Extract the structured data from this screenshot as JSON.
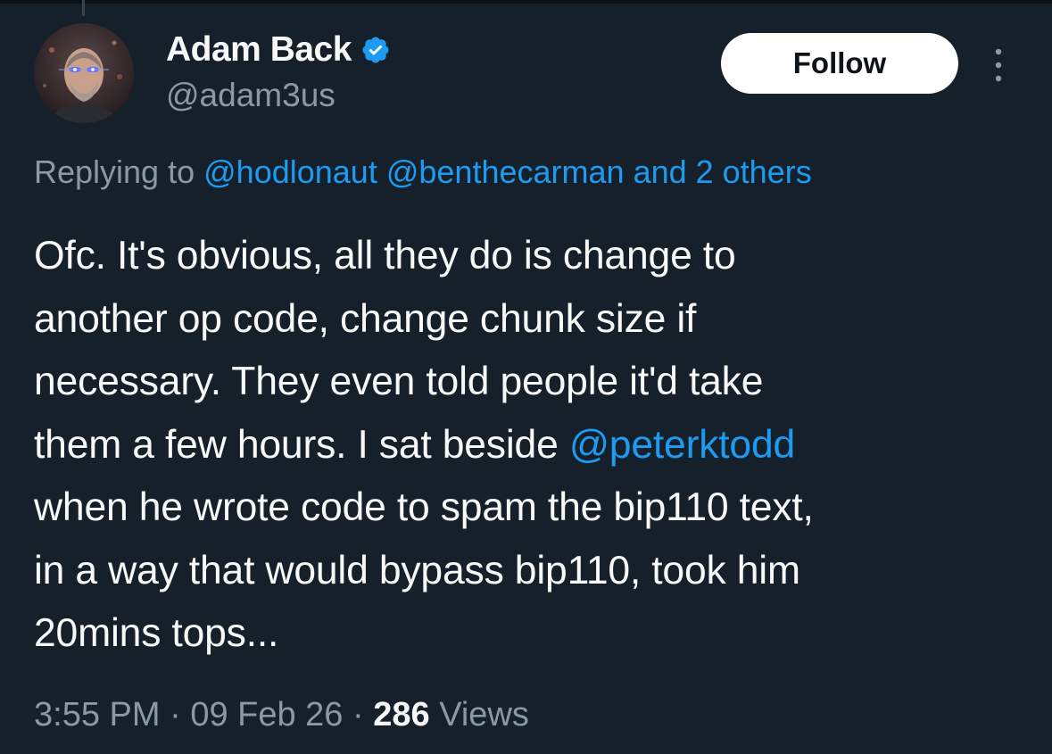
{
  "author": {
    "display_name": "Adam Back",
    "handle": "@adam3us",
    "verified_icon": "verified-badge-icon",
    "avatar_icon": "avatar-photo"
  },
  "actions": {
    "follow_label": "Follow",
    "more_icon": "more-vertical-icon"
  },
  "reply": {
    "prefix": "Replying to",
    "mention_1": "@hodlonaut",
    "mention_2": "@benthecarman",
    "others": "and 2 others"
  },
  "tweet": {
    "line_1": "Ofc. It's obvious, all they do is change to",
    "line_2": "another op code, change chunk size if",
    "line_3": "necessary. They even told people it'd take",
    "line_4_text": "them a few hours. I sat beside ",
    "line_4_mention": "@peterktodd",
    "line_5": "when he wrote code to spam the bip110 text,",
    "line_6": "in a way that would bypass bip110, took him",
    "line_7": "20mins tops..."
  },
  "meta": {
    "time": "3:55 PM",
    "separator": "·",
    "date": "09 Feb 26",
    "views_count": "286",
    "views_label": "Views"
  },
  "colors": {
    "background": "#15202b",
    "text": "#f7f9f9",
    "secondary": "#8b98a5",
    "link": "#1d9bf0",
    "button_bg": "#ffffff"
  }
}
